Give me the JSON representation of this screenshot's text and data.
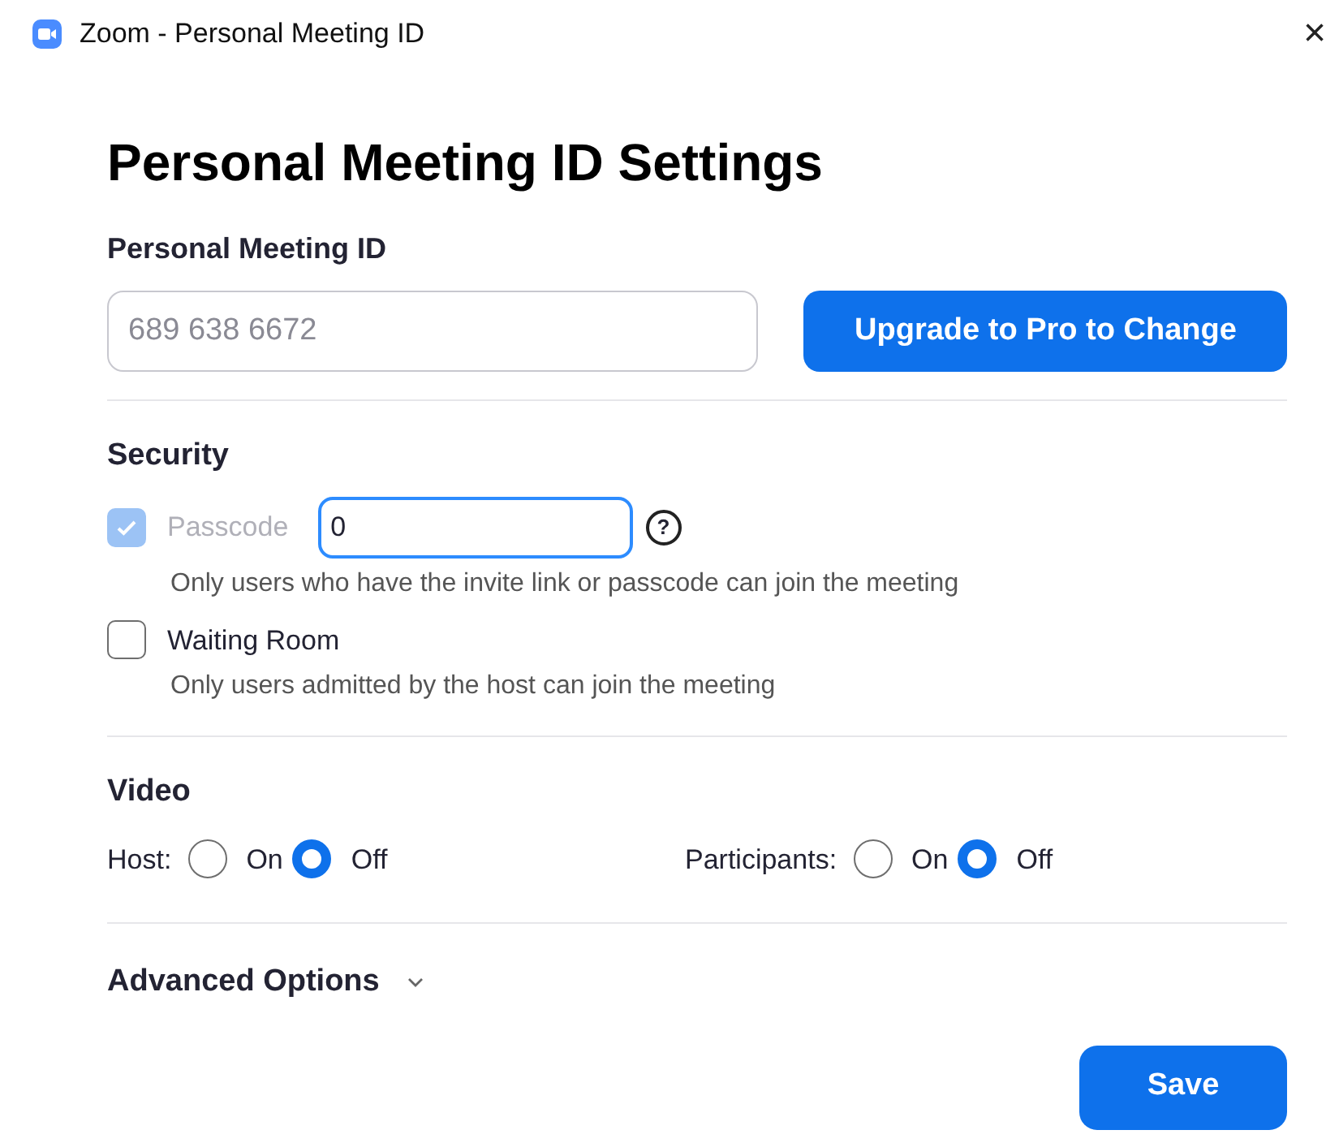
{
  "window": {
    "title": "Zoom - Personal Meeting ID",
    "close": "×"
  },
  "heading": "Personal Meeting ID Settings",
  "meeting_id": {
    "label": "Personal Meeting ID",
    "value": "689 638 6672",
    "button": "Upgrade to Pro to Change"
  },
  "security": {
    "title": "Security",
    "options": [
      {
        "label": "Passcode",
        "checked": true,
        "disabled": true,
        "value": "0",
        "help": "?",
        "description": "Only users who have the invite link or passcode can join the meeting"
      },
      {
        "label": "Waiting Room",
        "checked": false,
        "disabled": false,
        "description": "Only users admitted by the host can join the meeting"
      }
    ]
  },
  "video": {
    "title": "Video",
    "groups": [
      {
        "label": "Host:",
        "options": [
          {
            "label": "On",
            "selected": false
          },
          {
            "label": "Off",
            "selected": true
          }
        ]
      },
      {
        "label": "Participants:",
        "options": [
          {
            "label": "On",
            "selected": false
          },
          {
            "label": "Off",
            "selected": true
          }
        ]
      }
    ]
  },
  "advanced": {
    "label": "Advanced Options",
    "expanded": false
  },
  "save_button": "Save"
}
